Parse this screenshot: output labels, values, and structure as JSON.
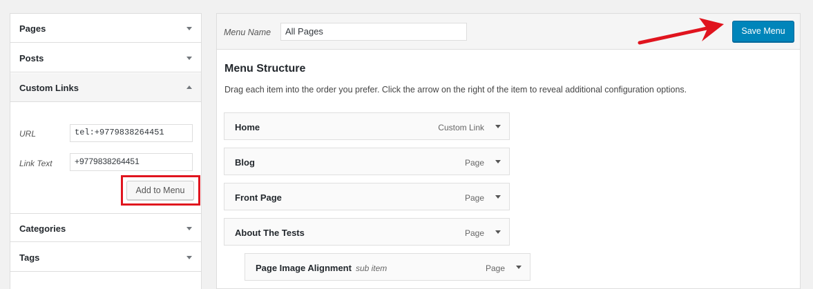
{
  "sidebar": {
    "sections": [
      {
        "label": "Pages",
        "state": "collapsed"
      },
      {
        "label": "Posts",
        "state": "collapsed"
      },
      {
        "label": "Custom Links",
        "state": "expanded"
      },
      {
        "label": "Categories",
        "state": "collapsed"
      },
      {
        "label": "Tags",
        "state": "collapsed"
      }
    ],
    "custom_links": {
      "url_label": "URL",
      "url_value": "tel:+9779838264451",
      "link_text_label": "Link Text",
      "link_text_value": "+9779838264451",
      "add_button": "Add to Menu"
    }
  },
  "menu": {
    "name_label": "Menu Name",
    "name_value": "All Pages",
    "save_button": "Save Menu",
    "structure_title": "Menu Structure",
    "structure_desc": "Drag each item into the order you prefer. Click the arrow on the right of the item to reveal additional configuration options.",
    "items": [
      {
        "title": "Home",
        "type": "Custom Link",
        "sub": ""
      },
      {
        "title": "Blog",
        "type": "Page",
        "sub": ""
      },
      {
        "title": "Front Page",
        "type": "Page",
        "sub": ""
      },
      {
        "title": "About The Tests",
        "type": "Page",
        "sub": ""
      },
      {
        "title": "Page Image Alignment",
        "type": "Page",
        "sub": "sub item"
      }
    ]
  },
  "colors": {
    "primary_button": "#0085ba",
    "highlight": "#e0141e"
  }
}
